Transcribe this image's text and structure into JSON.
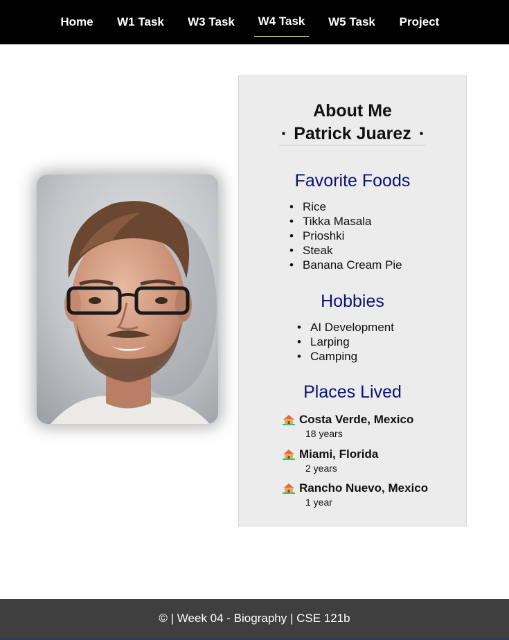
{
  "nav": {
    "items": [
      {
        "label": "Home"
      },
      {
        "label": "W1 Task"
      },
      {
        "label": "W3 Task"
      },
      {
        "label": "W4 Task",
        "active": true
      },
      {
        "label": "W5 Task"
      },
      {
        "label": "Project"
      }
    ]
  },
  "card": {
    "title": "About Me",
    "name": "Patrick Juarez",
    "foods": {
      "heading": "Favorite Foods",
      "items": [
        "Rice",
        "Tikka Masala",
        "Prioshki",
        "Steak",
        "Banana Cream Pie"
      ]
    },
    "hobbies": {
      "heading": "Hobbies",
      "items": [
        "AI Development",
        "Larping",
        "Camping"
      ]
    },
    "places": {
      "heading": "Places Lived",
      "items": [
        {
          "name": "Costa Verde, Mexico",
          "years": "18 years",
          "icon": "house-icon"
        },
        {
          "name": "Miami, Florida",
          "years": "2 years",
          "icon": "house-icon"
        },
        {
          "name": "Rancho Nuevo, Mexico",
          "years": "1 year",
          "icon": "house-icon"
        }
      ]
    }
  },
  "footer": {
    "text": "© | Week 04 - Biography | CSE 121b"
  },
  "colors": {
    "nav_bg": "#000000",
    "heading_blue": "#0b1170",
    "card_bg": "#ececec",
    "footer_bg": "#3f3f3f",
    "active_underline": "#d7d58a"
  }
}
